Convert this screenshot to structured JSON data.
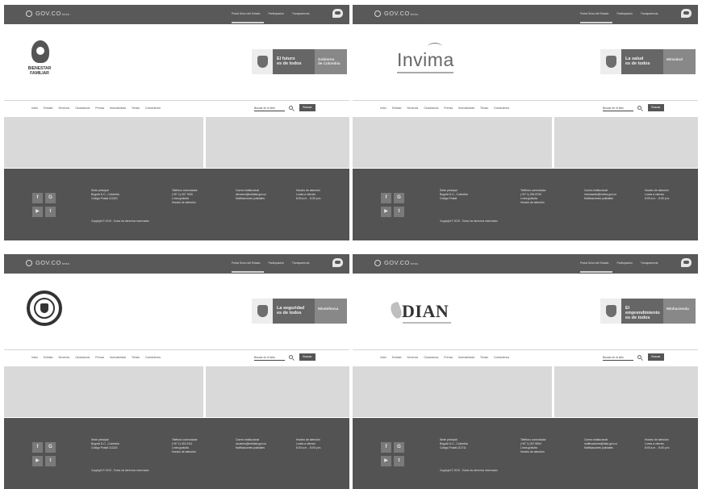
{
  "colors": {
    "top_bar": "#595959",
    "footer": "#535353",
    "content_placeholder": "#d9d9d9",
    "banner_slogan": "#666666",
    "banner_entity": "#888888"
  },
  "panels": [
    {
      "top_bar": {
        "brand": "GOV.CO",
        "brand_small": "beta",
        "links": [
          "Portal Único del Estado",
          "Participación",
          "Transparencia"
        ]
      },
      "logo_kind": "bienestar",
      "logo_text": "BIENESTAR\nFAMILIAR",
      "banner": {
        "slogan": "El futuro\nes de todos",
        "entity": "Gobierno\nde Colombia"
      },
      "nav": {
        "menu": [
          "Inicio",
          "Entidad",
          "Servicios",
          "Ciudadanos",
          "Prensa",
          "Normatividad",
          "Temas",
          "Contáctenos"
        ],
        "search_placeholder": "Buscar en el sitio",
        "search_button": "Buscar"
      },
      "footer": {
        "address": "Sede principal\nBogotá D.C., Colombia\nCódigo Postal 111321",
        "phones": "Teléfono conmutador\n(+57 1) 437 7630\nLínea gratuita\nHorario de atención",
        "emails": "Correo institucional\natencion@entidad.gov.co\nNotificaciones judiciales",
        "hours": "Horario de atención\nLunes a viernes\n8:00 a.m. - 5:00 p.m.",
        "copyright": "Copyright © 2019 - Todos los derechos reservados"
      }
    },
    {
      "top_bar": {
        "brand": "GOV.CO",
        "brand_small": "beta",
        "links": [
          "Portal Único del Estado",
          "Participación",
          "Transparencia"
        ]
      },
      "logo_kind": "invima",
      "logo_text": "Invima",
      "banner": {
        "slogan": "La salud\nes de todos",
        "entity": "Minsalud"
      },
      "nav": {
        "menu": [
          "Inicio",
          "Entidad",
          "Servicios",
          "Ciudadanos",
          "Prensa",
          "Normatividad",
          "Temas",
          "Contáctenos"
        ],
        "search_placeholder": "Buscar en el sitio",
        "search_button": "Buscar"
      },
      "footer": {
        "address": "Sede principal\nBogotá D.C., Colombia\nCódigo Postal",
        "phones": "Teléfono conmutador\n(+57 1) 294 8700\nLínea gratuita\nHorario de atención",
        "emails": "Correo institucional\ninvimaweb@invima.gov.co\nNotificaciones judiciales",
        "hours": "Horario de atención\nLunes a viernes\n8:00 a.m. - 5:00 p.m.",
        "copyright": "Copyright © 2019 - Todos los derechos reservados"
      }
    },
    {
      "top_bar": {
        "brand": "GOV.CO",
        "brand_small": "beta",
        "links": [
          "Portal Único del Estado",
          "Participación",
          "Transparencia"
        ]
      },
      "logo_kind": "seal",
      "logo_text": "",
      "banner": {
        "slogan": "La seguridad\nes de todos",
        "entity": "Mindefensa"
      },
      "nav": {
        "menu": [
          "Inicio",
          "Entidad",
          "Servicios",
          "Ciudadanos",
          "Prensa",
          "Normatividad",
          "Temas",
          "Contáctenos"
        ],
        "search_placeholder": "Buscar en el sitio",
        "search_button": "Buscar"
      },
      "footer": {
        "address": "Sede principal\nBogotá D.C., Colombia\nCódigo Postal 111321",
        "phones": "Teléfono conmutador\n(+57 1) 315 0111\nLínea gratuita\nHorario de atención",
        "emails": "Correo institucional\nusuarios@entidad.gov.co\nNotificaciones judiciales",
        "hours": "Horario de atención\nLunes a viernes\n8:00 a.m. - 5:00 p.m.",
        "copyright": "Copyright © 2019 - Todos los derechos reservados"
      }
    },
    {
      "top_bar": {
        "brand": "GOV.CO",
        "brand_small": "beta",
        "links": [
          "Portal Único del Estado",
          "Participación",
          "Transparencia"
        ]
      },
      "logo_kind": "dian",
      "logo_text": "DIAN",
      "banner": {
        "slogan": "El emprendimiento\nes de todos",
        "entity": "Minhacienda"
      },
      "nav": {
        "menu": [
          "Inicio",
          "Entidad",
          "Servicios",
          "Ciudadanos",
          "Prensa",
          "Normatividad",
          "Temas",
          "Contáctenos"
        ],
        "search_placeholder": "Buscar en el sitio",
        "search_button": "Buscar"
      },
      "footer": {
        "address": "Sede principal\nBogotá D.C., Colombia\nCódigo Postal 111711",
        "phones": "Teléfono conmutador\n(+57 1) 307 8064\nLínea gratuita\nHorario de atención",
        "emails": "Correo institucional\nnotificaciones@dian.gov.co\nNotificaciones judiciales",
        "hours": "Horario de atención\nLunes a viernes\n8:00 a.m. - 5:00 p.m.",
        "copyright": "Copyright © 2019 - Todos los derechos reservados"
      }
    }
  ],
  "social_icons": [
    "facebook-icon",
    "google-plus-icon",
    "youtube-icon",
    "twitter-icon"
  ]
}
